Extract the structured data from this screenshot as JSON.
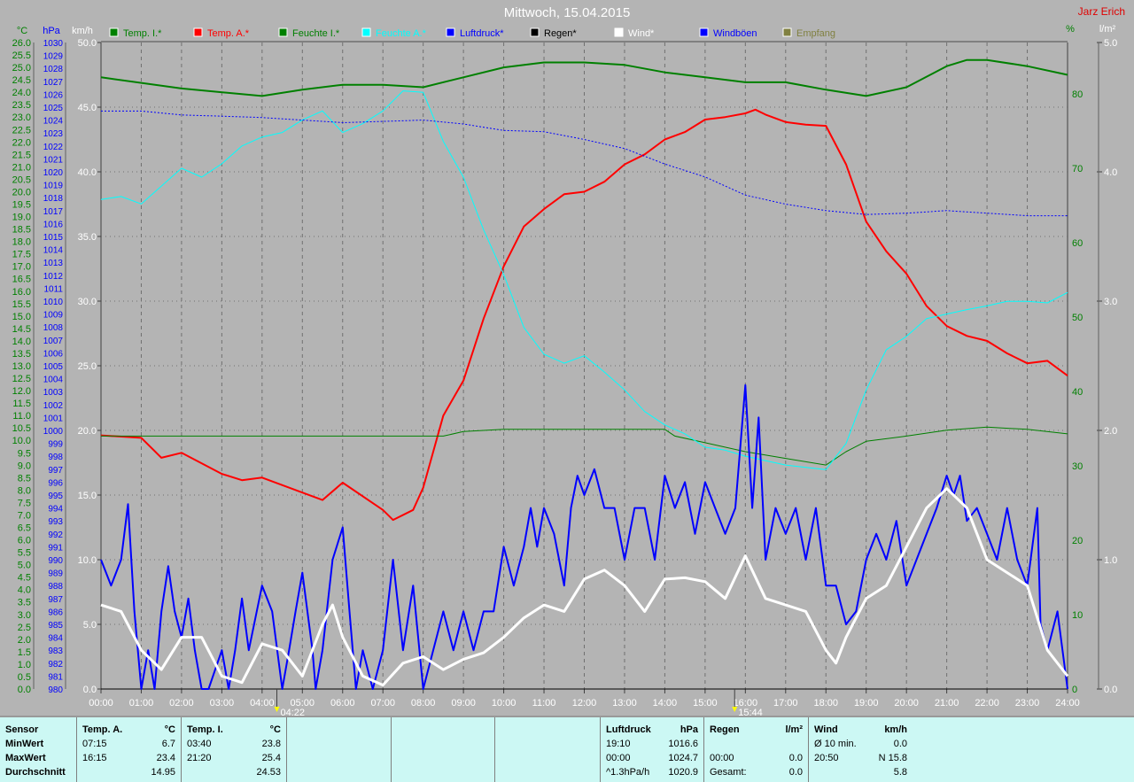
{
  "header": {
    "title": "Mittwoch, 15.04.2015",
    "author": "Jarz Erich"
  },
  "legend": [
    {
      "label": "Temp. I.*",
      "color": "#008000"
    },
    {
      "label": "Temp. A.*",
      "color": "#ff0000"
    },
    {
      "label": "Feuchte I.*",
      "color": "#008000"
    },
    {
      "label": "Feuchte A.*",
      "color": "#00ffff"
    },
    {
      "label": "Luftdruck*",
      "color": "#0000ff"
    },
    {
      "label": "Regen*",
      "color": "#000000"
    },
    {
      "label": "Wind*",
      "color": "#ffffff"
    },
    {
      "label": "Windböen",
      "color": "#0000ff"
    },
    {
      "label": "Empfang",
      "color": "#808040"
    }
  ],
  "markers": [
    "04:22",
    "15:44"
  ],
  "chart_data": {
    "type": "line",
    "title": "Mittwoch, 15.04.2015",
    "x_ticks": [
      "00:00",
      "01:00",
      "02:00",
      "03:00",
      "04:00",
      "05:00",
      "06:00",
      "07:00",
      "08:00",
      "09:00",
      "10:00",
      "11:00",
      "12:00",
      "13:00",
      "14:00",
      "15:00",
      "16:00",
      "17:00",
      "18:00",
      "19:00",
      "20:00",
      "21:00",
      "22:00",
      "23:00",
      "24:00"
    ],
    "xlim": [
      0,
      24
    ],
    "axes": {
      "temp": {
        "unit": "°C",
        "ylim": [
          0,
          26
        ],
        "step": 0.5,
        "color": "#008000"
      },
      "pressure": {
        "unit": "hPa",
        "ylim": [
          980,
          1030
        ],
        "step": 1,
        "color": "#0000ff"
      },
      "wind": {
        "unit": "km/h",
        "ylim": [
          0,
          50
        ],
        "step": 5,
        "color": "#ffffff"
      },
      "humidity": {
        "unit": "%",
        "ylim": [
          0,
          86.9
        ],
        "ticks": [
          0,
          10,
          20,
          30,
          40,
          50,
          60,
          70,
          80
        ],
        "color": "#008000"
      },
      "rain": {
        "unit": "l/m²",
        "ylim": [
          0,
          5
        ],
        "ticks": [
          0,
          1,
          2,
          3,
          4,
          5
        ],
        "color": "#ffffff"
      }
    },
    "series": [
      {
        "name": "Temp. I.*",
        "axis": "temp",
        "color": "#008000",
        "width": 2,
        "x": [
          0,
          2,
          4,
          5,
          6,
          7,
          8,
          9,
          10,
          11,
          12,
          13,
          14,
          15,
          16,
          17,
          18,
          19,
          20,
          21,
          21.5,
          22,
          23,
          24
        ],
        "y": [
          24.6,
          24.15,
          23.85,
          24.1,
          24.3,
          24.3,
          24.2,
          24.6,
          25.0,
          25.2,
          25.2,
          25.1,
          24.8,
          24.6,
          24.4,
          24.4,
          24.1,
          23.85,
          24.2,
          25.05,
          25.3,
          25.3,
          25.05,
          24.7
        ]
      },
      {
        "name": "Temp. A.*",
        "axis": "temp",
        "color": "#ff0000",
        "width": 2,
        "x": [
          0,
          1,
          1.5,
          2,
          3,
          3.5,
          4,
          5,
          5.5,
          6,
          7,
          7.25,
          7.75,
          8,
          8.5,
          9,
          9.5,
          10,
          10.5,
          11,
          11.5,
          12,
          12.5,
          13,
          13.5,
          14,
          14.5,
          15,
          15.5,
          16,
          16.25,
          16.5,
          17,
          17.5,
          18,
          18.5,
          19,
          19.5,
          20,
          20.5,
          21,
          21.5,
          22,
          22.5,
          23,
          23.5,
          24
        ],
        "y": [
          10.2,
          10.1,
          9.3,
          9.5,
          8.65,
          8.4,
          8.5,
          7.9,
          7.6,
          8.3,
          7.2,
          6.8,
          7.2,
          8.1,
          11,
          12.4,
          14.9,
          17,
          18.6,
          19.3,
          19.9,
          20,
          20.4,
          21.1,
          21.5,
          22.1,
          22.4,
          22.9,
          23,
          23.15,
          23.3,
          23.1,
          22.8,
          22.7,
          22.65,
          21.1,
          18.8,
          17.6,
          16.7,
          15.4,
          14.6,
          14.2,
          14,
          13.5,
          13.1,
          13.2,
          12.6
        ]
      },
      {
        "name": "Feuchte I.*",
        "axis": "humidity",
        "color": "#008000",
        "width": 1,
        "x": [
          0,
          8.5,
          9,
          10,
          14,
          14.25,
          15,
          16,
          17,
          18,
          18.5,
          19,
          20,
          21,
          22,
          23,
          24
        ],
        "y": [
          34,
          34,
          34.6,
          34.9,
          34.9,
          34,
          33.1,
          31.9,
          31,
          30.1,
          31.9,
          33.3,
          34,
          34.8,
          35.2,
          34.9,
          34.3
        ]
      },
      {
        "name": "Feuchte A.*",
        "axis": "humidity",
        "color": "#00ffff",
        "width": 1,
        "x": [
          0,
          0.5,
          1,
          1.5,
          2,
          2.5,
          3,
          3.5,
          4,
          4.5,
          5,
          5.5,
          6,
          6.5,
          7,
          7.5,
          8,
          8.5,
          9,
          9.5,
          10,
          10.5,
          11,
          11.5,
          12,
          12.5,
          13,
          13.5,
          14,
          14.5,
          15,
          15.5,
          16,
          16.5,
          17,
          17.5,
          18,
          18.5,
          19,
          19.5,
          20,
          20.5,
          21,
          21.5,
          22,
          22.5,
          23,
          23.5,
          24
        ],
        "y": [
          65.8,
          66.2,
          65.2,
          67.6,
          70,
          68.8,
          70.6,
          73,
          74.2,
          74.8,
          76.5,
          77.7,
          74.8,
          76,
          77.7,
          80.4,
          80.2,
          73.6,
          68.8,
          61.7,
          55.7,
          48.6,
          45,
          43.8,
          44.8,
          42.6,
          40.2,
          37.3,
          35.5,
          34.3,
          32.5,
          32.1,
          31.3,
          30.7,
          30.1,
          29.8,
          29.5,
          33,
          40.2,
          45.6,
          47.4,
          49.8,
          50.4,
          51,
          51.5,
          52.1,
          52.1,
          51.9,
          53.3
        ]
      },
      {
        "name": "Luftdruck*",
        "axis": "pressure",
        "color": "#0000ff",
        "width": 1,
        "dash": true,
        "x": [
          0,
          1,
          2,
          3,
          4,
          5,
          6,
          7,
          8,
          9,
          10,
          11,
          12,
          13,
          14,
          15,
          16,
          17,
          18,
          19,
          20,
          21,
          22,
          23,
          24
        ],
        "y": [
          1024.7,
          1024.7,
          1024.4,
          1024.3,
          1024.2,
          1024,
          1023.8,
          1023.9,
          1024,
          1023.7,
          1023.2,
          1023.1,
          1022.5,
          1021.8,
          1020.6,
          1019.6,
          1018.2,
          1017.5,
          1017,
          1016.7,
          1016.8,
          1017,
          1016.8,
          1016.6,
          1016.6
        ]
      },
      {
        "name": "Regen*",
        "axis": "rain",
        "color": "#000000",
        "width": 1,
        "x": [
          0,
          24
        ],
        "y": [
          0,
          0
        ]
      },
      {
        "name": "Windböen",
        "axis": "wind",
        "color": "#0000ff",
        "width": 2,
        "x": [
          0,
          0.25,
          0.5,
          0.67,
          0.83,
          1,
          1.17,
          1.33,
          1.5,
          1.67,
          1.83,
          2,
          2.17,
          2.33,
          2.5,
          2.67,
          3,
          3.17,
          3.33,
          3.5,
          3.67,
          4,
          4.25,
          4.5,
          4.67,
          4.83,
          5,
          5.25,
          5.33,
          5.5,
          5.75,
          6,
          6.17,
          6.33,
          6.5,
          6.75,
          7,
          7.25,
          7.5,
          7.75,
          8,
          8.25,
          8.5,
          8.75,
          9,
          9.25,
          9.5,
          9.75,
          10,
          10.25,
          10.5,
          10.67,
          10.83,
          11,
          11.25,
          11.5,
          11.67,
          11.83,
          12,
          12.25,
          12.5,
          12.75,
          13,
          13.25,
          13.5,
          13.75,
          14,
          14.25,
          14.5,
          14.75,
          15,
          15.25,
          15.5,
          15.75,
          16,
          16.17,
          16.33,
          16.5,
          16.75,
          17,
          17.25,
          17.5,
          17.75,
          18,
          18.25,
          18.5,
          18.75,
          19,
          19.25,
          19.5,
          19.75,
          20,
          20.25,
          20.5,
          20.75,
          21,
          21.17,
          21.33,
          21.5,
          21.75,
          22,
          22.25,
          22.5,
          22.75,
          23,
          23.25,
          23.33,
          23.5,
          23.75,
          24
        ],
        "y": [
          10,
          8,
          10,
          14.3,
          6,
          0,
          3,
          0,
          6,
          9.5,
          6,
          4,
          7,
          3,
          0,
          0,
          3,
          0,
          3,
          7,
          3,
          8,
          6,
          0,
          3,
          6,
          9,
          3,
          0,
          3,
          10,
          12.5,
          6,
          0,
          3,
          0,
          3,
          10,
          3,
          8,
          0,
          3,
          6,
          3,
          6,
          3,
          6,
          6,
          11,
          8,
          11,
          14,
          11,
          14,
          12,
          8,
          14,
          16.5,
          15,
          17,
          14,
          14,
          10,
          14,
          14,
          10,
          16.5,
          14,
          16,
          12,
          16,
          14,
          12,
          14,
          23.5,
          14,
          21,
          10,
          14,
          12,
          14,
          10,
          14,
          8,
          8,
          5,
          6,
          10,
          12,
          10,
          13,
          8,
          10,
          12,
          14,
          16.5,
          15,
          16.5,
          13,
          14,
          12,
          10,
          14,
          10,
          8,
          14,
          5,
          3,
          6,
          0
        ]
      },
      {
        "name": "Wind*",
        "axis": "wind",
        "color": "#ffffff",
        "width": 3,
        "x": [
          0,
          0.5,
          1,
          1.5,
          2,
          2.5,
          3,
          3.5,
          4,
          4.5,
          5,
          5.5,
          5.75,
          6,
          6.5,
          7,
          7.5,
          8,
          8.5,
          9,
          9.5,
          10,
          10.5,
          11,
          11.5,
          12,
          12.5,
          13,
          13.5,
          14,
          14.5,
          15,
          15.5,
          16,
          16.5,
          17,
          17.5,
          18,
          18.25,
          18.5,
          19,
          19.5,
          20,
          20.5,
          21,
          21.5,
          22,
          22.5,
          23,
          23.5,
          24
        ],
        "y": [
          6.5,
          6,
          3,
          1.5,
          4,
          4,
          1,
          0.5,
          3.5,
          3,
          1,
          5,
          6.5,
          4,
          1,
          0.3,
          2,
          2.5,
          1.5,
          2.3,
          2.8,
          4,
          5.5,
          6.5,
          6,
          8.5,
          9.2,
          8,
          6,
          8.5,
          8.6,
          8.3,
          7,
          10.3,
          7,
          6.5,
          6,
          3,
          2,
          4,
          7,
          8,
          11,
          14,
          15.5,
          14,
          10,
          9,
          8,
          3,
          1
        ]
      }
    ]
  },
  "stats": {
    "sensor_label": "Sensor",
    "row_labels": [
      "MinWert",
      "MaxWert",
      "Durchschnitt"
    ],
    "temp_a": {
      "title": "Temp. A.",
      "unit": "°C",
      "min_time": "07:15",
      "min": "6.7",
      "max_time": "16:15",
      "max": "23.4",
      "avg": "14.95"
    },
    "temp_i": {
      "title": "Temp. I.",
      "unit": "°C",
      "min_time": "03:40",
      "min": "23.8",
      "max_time": "21:20",
      "max": "25.4",
      "avg": "24.53"
    },
    "pressure": {
      "title": "Luftdruck",
      "unit": "hPa",
      "min_time": "19:10",
      "min": "1016.6",
      "max_time": "00:00",
      "max": "1024.7",
      "trend": "^1.3hPa/h",
      "avg": "1020.9"
    },
    "rain": {
      "title": "Regen",
      "unit": "l/m²",
      "max_time": "00:00",
      "max": "0.0",
      "total_label": "Gesamt:",
      "total": "0.0"
    },
    "wind": {
      "title": "Wind",
      "unit": "km/h",
      "avg10_label": "Ø 10 min.",
      "avg10": "0.0",
      "max_time": "20:50",
      "max": "N 15.8",
      "avg": "5.8"
    }
  }
}
